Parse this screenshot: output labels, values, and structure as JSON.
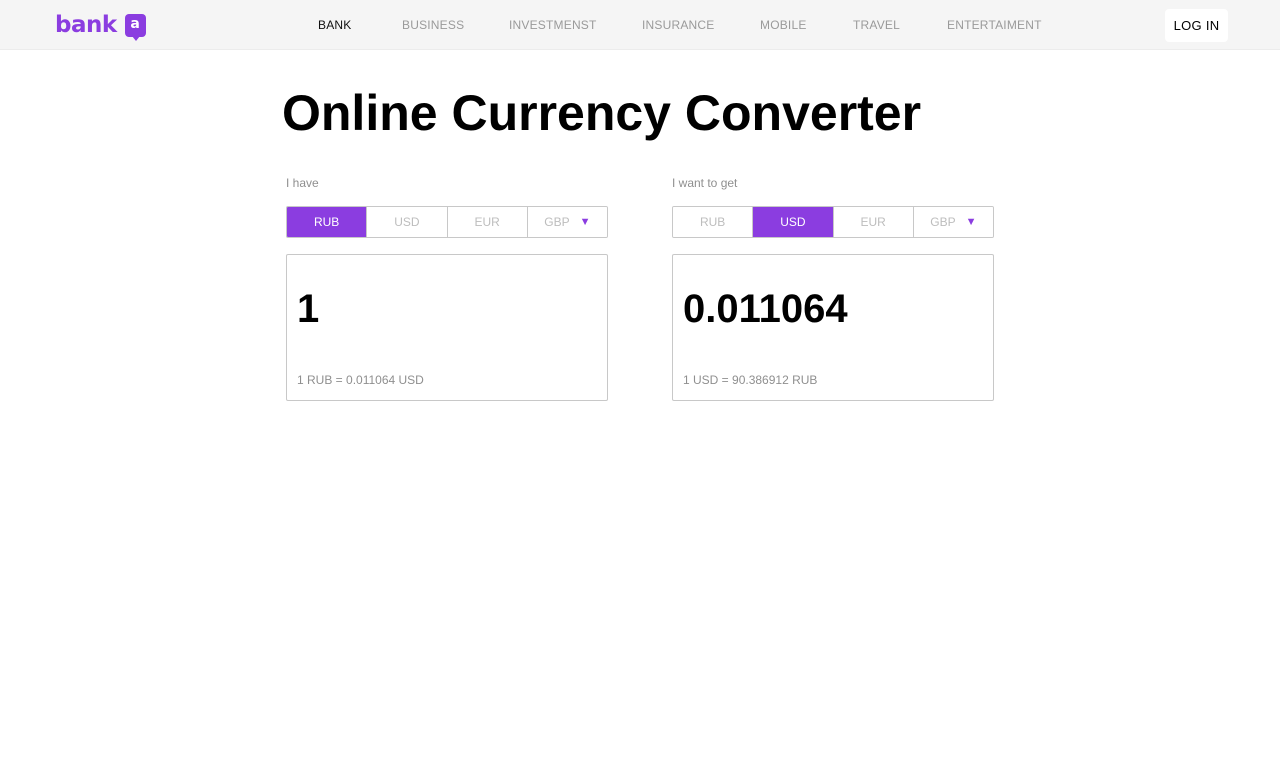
{
  "header": {
    "logo_text": "bank",
    "logo_badge": "a",
    "nav": [
      {
        "label": "BANK",
        "active": true
      },
      {
        "label": "BUSINESS",
        "active": false
      },
      {
        "label": "INVESTMENST",
        "active": false
      },
      {
        "label": "INSURANCE",
        "active": false
      },
      {
        "label": "MOBILE",
        "active": false
      },
      {
        "label": "TRAVEL",
        "active": false
      },
      {
        "label": "ENTERTAIMENT",
        "active": false
      }
    ],
    "login_label": "LOG IN"
  },
  "page": {
    "title": "Online Currency Converter"
  },
  "have": {
    "label": "I have",
    "currencies": [
      "RUB",
      "USD",
      "EUR",
      "GBP"
    ],
    "selected": "RUB",
    "value": "1",
    "rate": "1 RUB = 0.011064 USD"
  },
  "want": {
    "label": "I want to get",
    "currencies": [
      "RUB",
      "USD",
      "EUR",
      "GBP"
    ],
    "selected": "USD",
    "value": "0.011064",
    "rate": "1 USD = 90.386912 RUB"
  },
  "colors": {
    "accent": "#8b3de0",
    "header_bg": "#f5f5f5",
    "muted_text": "#8f8f8f"
  },
  "icons": {
    "dropdown": "caret-down-icon"
  }
}
